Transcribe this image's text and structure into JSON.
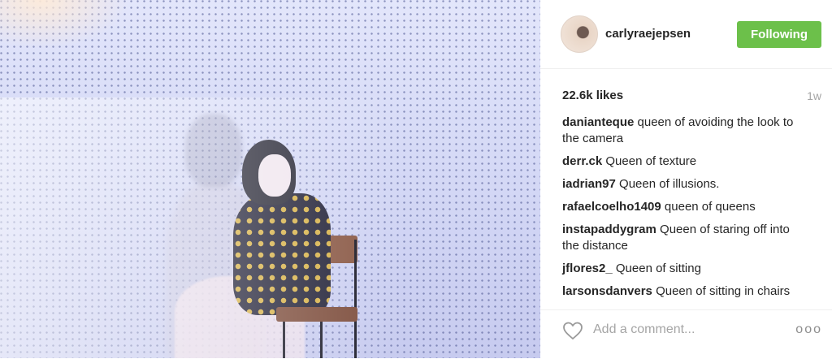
{
  "post": {
    "author": {
      "username": "carlyraejepsen",
      "follow_label": "Following"
    },
    "likes_label": "22.6k likes",
    "age": "1w",
    "comments": [
      {
        "user": "danianteque",
        "text": "queen of avoiding the look to the camera"
      },
      {
        "user": "derr.ck",
        "text": "Queen of texture"
      },
      {
        "user": "iadrian97",
        "text": "Queen of illusions."
      },
      {
        "user": "rafaelcoelho1409",
        "text": "queen of queens"
      },
      {
        "user": "instapaddygram",
        "text": "Queen of staring off into the distance"
      },
      {
        "user": "jflores2_",
        "text": "Queen of sitting"
      },
      {
        "user": "larsonsdanvers",
        "text": "Queen of sitting in chairs"
      }
    ],
    "composer": {
      "placeholder": "Add a comment..."
    },
    "more_label": "ooo"
  },
  "colors": {
    "follow_button": "#6cc04a",
    "muted_text": "#a5a5a5"
  },
  "icons": {
    "like": "heart-icon",
    "options": "more-options-icon"
  }
}
